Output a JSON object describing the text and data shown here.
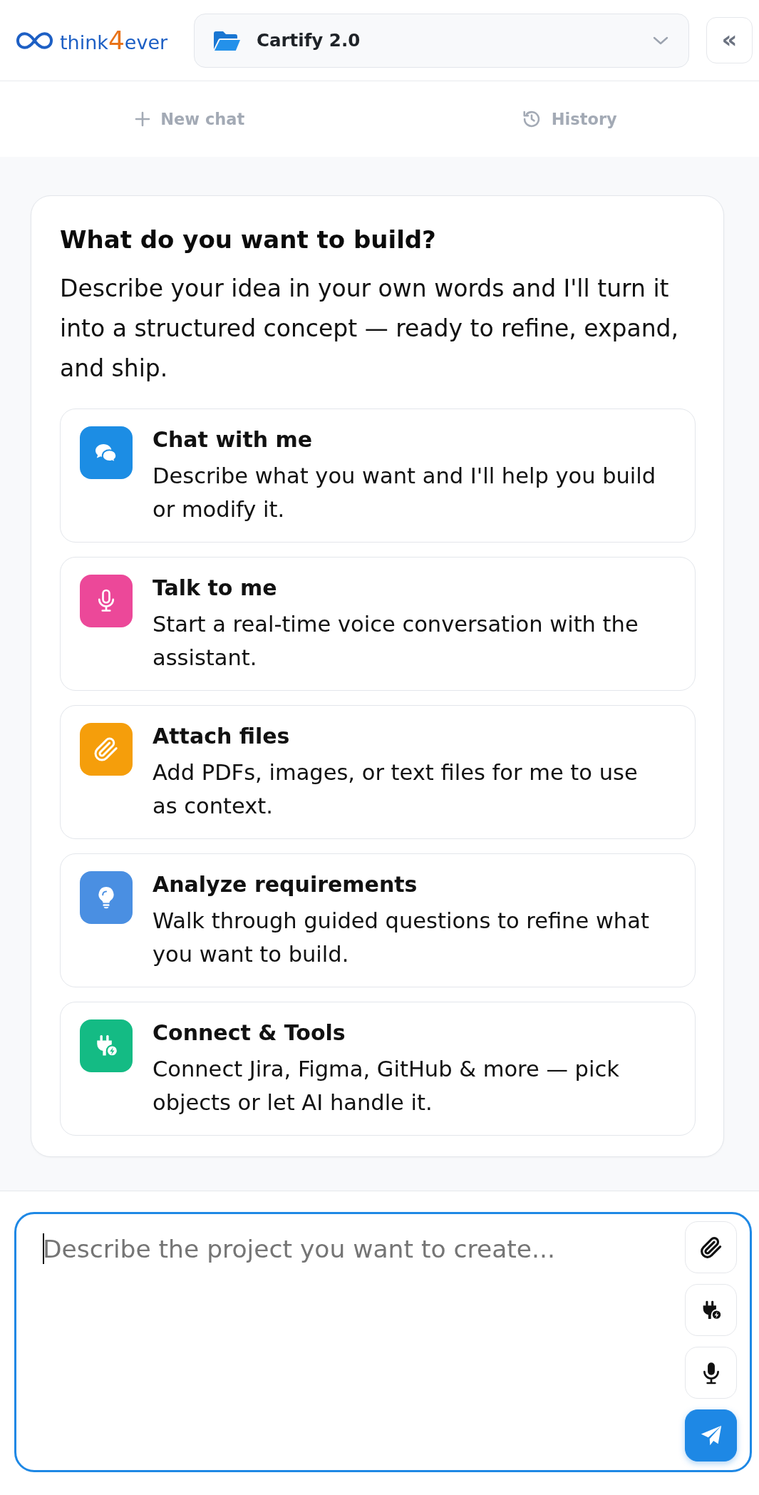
{
  "header": {
    "logo": {
      "text": "think",
      "accent": "4",
      "text_end": "ever"
    },
    "project_selector": {
      "label": "Cartify 2.0"
    },
    "collapse_button": {
      "label": "«"
    }
  },
  "toolbar": [
    {
      "kind": "new",
      "label": "New chat",
      "disabled": true
    },
    {
      "kind": "history",
      "label": "History",
      "disabled": true
    }
  ],
  "intro_card": {
    "title": "What do you want to build?",
    "description": "Describe your idea in your own words and I'll turn it into a structured concept — ready to refine, expand, and ship.",
    "options": [
      {
        "kind": "chat",
        "color": "#1c8de4",
        "title": "Chat with me",
        "description": "Describe what you want and I'll help you build or modify it."
      },
      {
        "kind": "voice",
        "color": "#ec4899",
        "title": "Talk to me",
        "description": "Start a real-time voice conversation with the assistant."
      },
      {
        "kind": "attach",
        "color": "#f59e0b",
        "title": "Attach files",
        "description": "Add PDFs, images, or text files for me to use as context."
      },
      {
        "kind": "analyze",
        "color": "#4a8fe2",
        "title": "Analyze requirements",
        "description": "Walk through guided questions to refine what you want to build."
      },
      {
        "kind": "connect",
        "color": "#14bb84",
        "title": "Connect & Tools",
        "description": "Connect Jira, Figma, GitHub & more — pick objects or let AI handle it."
      }
    ]
  },
  "composer": {
    "placeholder": "Describe the project you want to create...",
    "focused": true,
    "actions": [
      {
        "kind": "attach"
      },
      {
        "kind": "connect"
      },
      {
        "kind": "voice"
      },
      {
        "kind": "send"
      }
    ]
  }
}
